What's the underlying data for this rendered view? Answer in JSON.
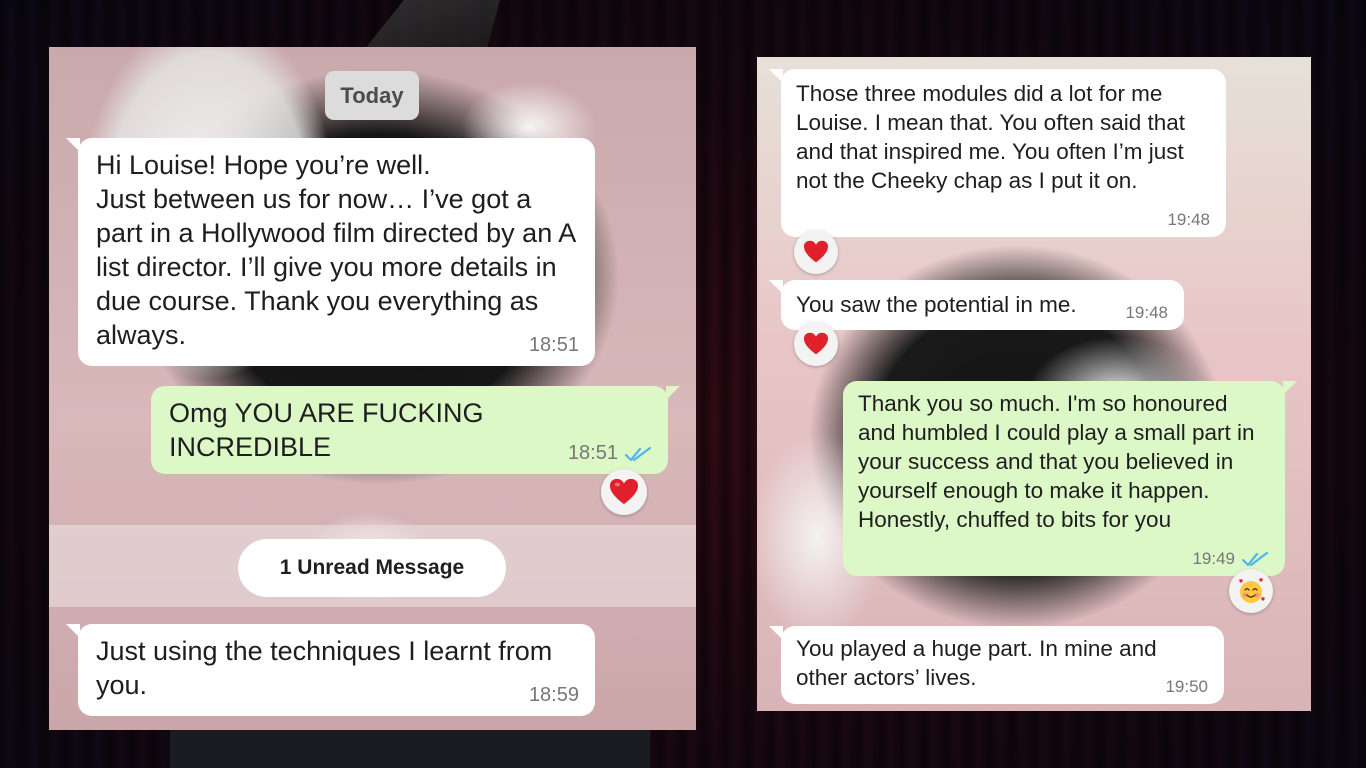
{
  "left_screenshot": {
    "date_separator": "Today",
    "unread_separator": "1 Unread Message",
    "messages": [
      {
        "direction": "incoming",
        "text": "Hi Louise! Hope you’re well.\nJust between us for now… I’ve got a part in a Hollywood film directed by an A list director. I’ll give you more details in due course. Thank you everything as always.",
        "time": "18:51"
      },
      {
        "direction": "outgoing",
        "text": "Omg YOU ARE FUCKING INCREDIBLE",
        "time": "18:51",
        "status": "read",
        "reaction": "red-heart"
      },
      {
        "direction": "incoming",
        "text": "Just using the techniques I learnt from you.",
        "time": "18:59"
      }
    ]
  },
  "right_screenshot": {
    "messages": [
      {
        "direction": "incoming",
        "text": "Those three modules did a lot for me Louise. I mean that. You often said that and that inspired me. You often I’m just not the Cheeky chap as I put it on.",
        "time": "19:48",
        "reaction": "red-heart"
      },
      {
        "direction": "incoming",
        "text": "You saw the potential in me.",
        "time": "19:48",
        "reaction": "red-heart"
      },
      {
        "direction": "outgoing",
        "text": "Thank you so much. I'm so honoured and humbled I could play a small part in your success and that you believed in yourself enough to make it happen. Honestly, chuffed to bits for you",
        "time": "19:49",
        "status": "read",
        "reaction": "smiling-face-with-hearts"
      },
      {
        "direction": "incoming",
        "text": "You played a huge part. In mine and other actors’ lives.",
        "time": "19:50"
      }
    ]
  },
  "colors": {
    "incoming_bubble": "#ffffff",
    "outgoing_bubble": "#dcf8c6",
    "read_ticks": "#4fb6ec",
    "timestamp": "#777777",
    "heart": "#e0202b"
  }
}
